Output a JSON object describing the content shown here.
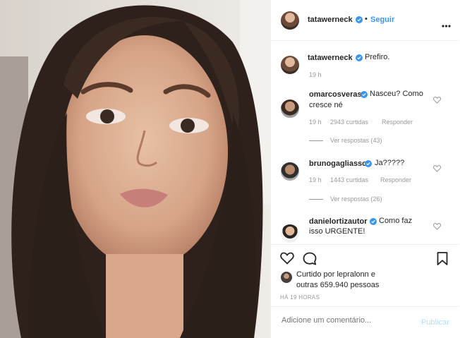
{
  "header": {
    "username": "tatawerneck",
    "separator": "•",
    "follow_label": "Seguir",
    "more_icon": "more-horizontal-icon"
  },
  "caption": {
    "username": "tatawerneck",
    "text": "Prefiro.",
    "time": "19 h"
  },
  "comments": [
    {
      "username": "omarcosveras",
      "text_line1": "Nasceu? Como",
      "text_line2": "cresce né",
      "time": "19 h",
      "likes": "2943 curtidas",
      "reply": "Responder",
      "view_replies": "Ver respostas (43)"
    },
    {
      "username": "brunogagliasso",
      "text_line1": "Ja?????",
      "time": "19 h",
      "likes": "1443 curtidas",
      "reply": "Responder",
      "view_replies": "Ver respostas (26)"
    },
    {
      "username": "danielortizautor",
      "text_line1": "Como faz",
      "text_line2": "isso URGENTE!"
    }
  ],
  "likes_line1_prefix": "Curtido por",
  "likes_user": "lepralonn",
  "likes_line1_suffix": "e",
  "likes_line2": "outras 659.940 pessoas",
  "post_time": "HÁ 19 HORAS",
  "add_comment": {
    "placeholder": "Adicione um comentário...",
    "publish_label": "Publicar"
  },
  "colors": {
    "accent": "#3897f0",
    "muted": "#999999",
    "border": "#efefef"
  }
}
